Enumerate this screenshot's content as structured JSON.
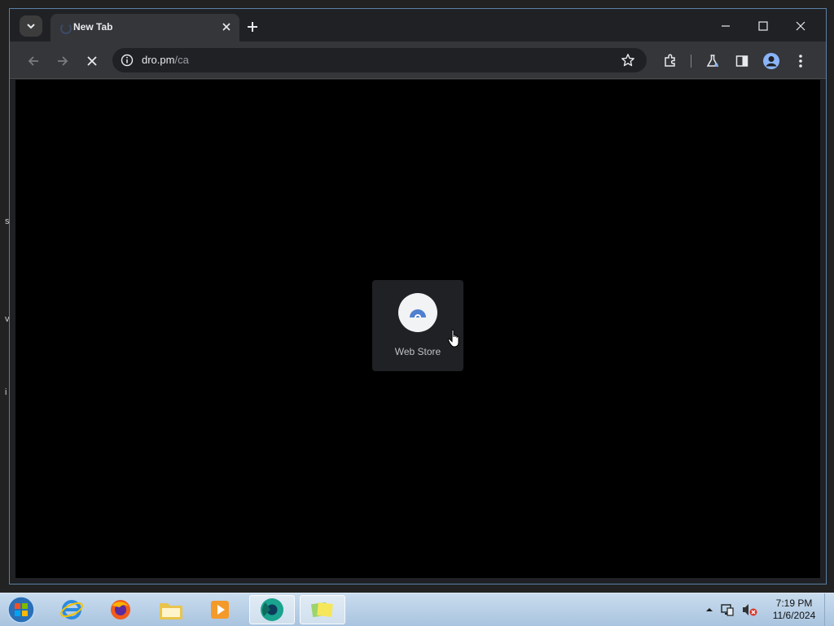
{
  "browser": {
    "tab": {
      "title": "New Tab"
    },
    "address": {
      "host": "dro.pm",
      "path": "/ca"
    }
  },
  "content": {
    "shortcut": {
      "label": "Web Store"
    }
  },
  "taskbar": {
    "clock": {
      "time": "7:19 PM",
      "date": "11/6/2024"
    },
    "apps": [
      "internet-explorer",
      "firefox",
      "file-explorer",
      "media-player",
      "chrome",
      "sticky-notes"
    ]
  },
  "colors": {
    "window_border": "#5a7fa8",
    "toolbar_bg": "#35363a",
    "content_bg": "#000000"
  }
}
